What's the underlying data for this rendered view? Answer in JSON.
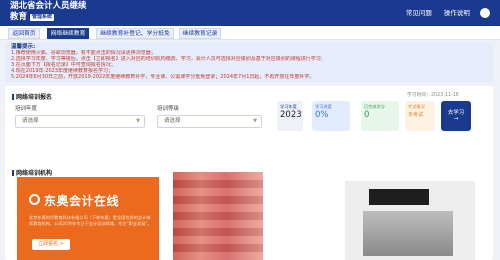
{
  "header": {
    "title_line1": "湖北省会计人员继续",
    "title_line2": "教育",
    "badge": "管理系统",
    "nav": [
      "常见问题",
      "操作说明"
    ],
    "colors": {
      "primary": "#1a3a8f"
    }
  },
  "tabs": [
    {
      "label": "返回首页",
      "active": false
    },
    {
      "label": "网络继续教育",
      "active": true
    },
    {
      "label": "继续教育补登记、学分抵免",
      "active": false
    },
    {
      "label": "继续教育记录",
      "active": false
    }
  ],
  "notice": {
    "title": "温馨提示:",
    "lines": [
      "1.推荐使用火狐、谷歌浏览器，有不能点击的情况请更换浏览器；",
      "2.选择学习年度、学习等级后，点击【立即报名】进入对应的培训机构缴费、学习，会计人员可选择对应级别及基于对应级别的课程进行学习;",
      "3.在页面下方【报名记录】中可查询报名情况；",
      "4.现在2019年-2023年度继续教育报名学习；",
      "5.2024年6月30日之前，开放2019-2022年度继续教育补学，专业课、公需课学分抵免登录；2024年7月1日起，不再开放往年度补学。"
    ]
  },
  "enroll": {
    "section_title": "网络培训报名",
    "year_label": "培训年度",
    "year_value": "请选择",
    "level_label": "培训等级",
    "level_value": "请选择",
    "date_label": "学习时间：2023-11-16"
  },
  "stats": {
    "year": {
      "label": "学习年度",
      "value": "2023"
    },
    "study": {
      "label": "学习进度",
      "value": "0%"
    },
    "done": {
      "label": "已完成学分",
      "value": "0"
    },
    "exam": {
      "label": "考试情况",
      "value": "未考试"
    },
    "go_button": "去学习"
  },
  "orgs": {
    "section_title": "网络培训机构",
    "featured": {
      "name": "东奥会计在线",
      "desc": "北京东奥时代教育科技有限公司（下称东奥）是全国优秀的会计继续教育机构，公司20余年专注于会计培训领域，专注“职业发展”。",
      "button": "立即报名 >"
    }
  }
}
